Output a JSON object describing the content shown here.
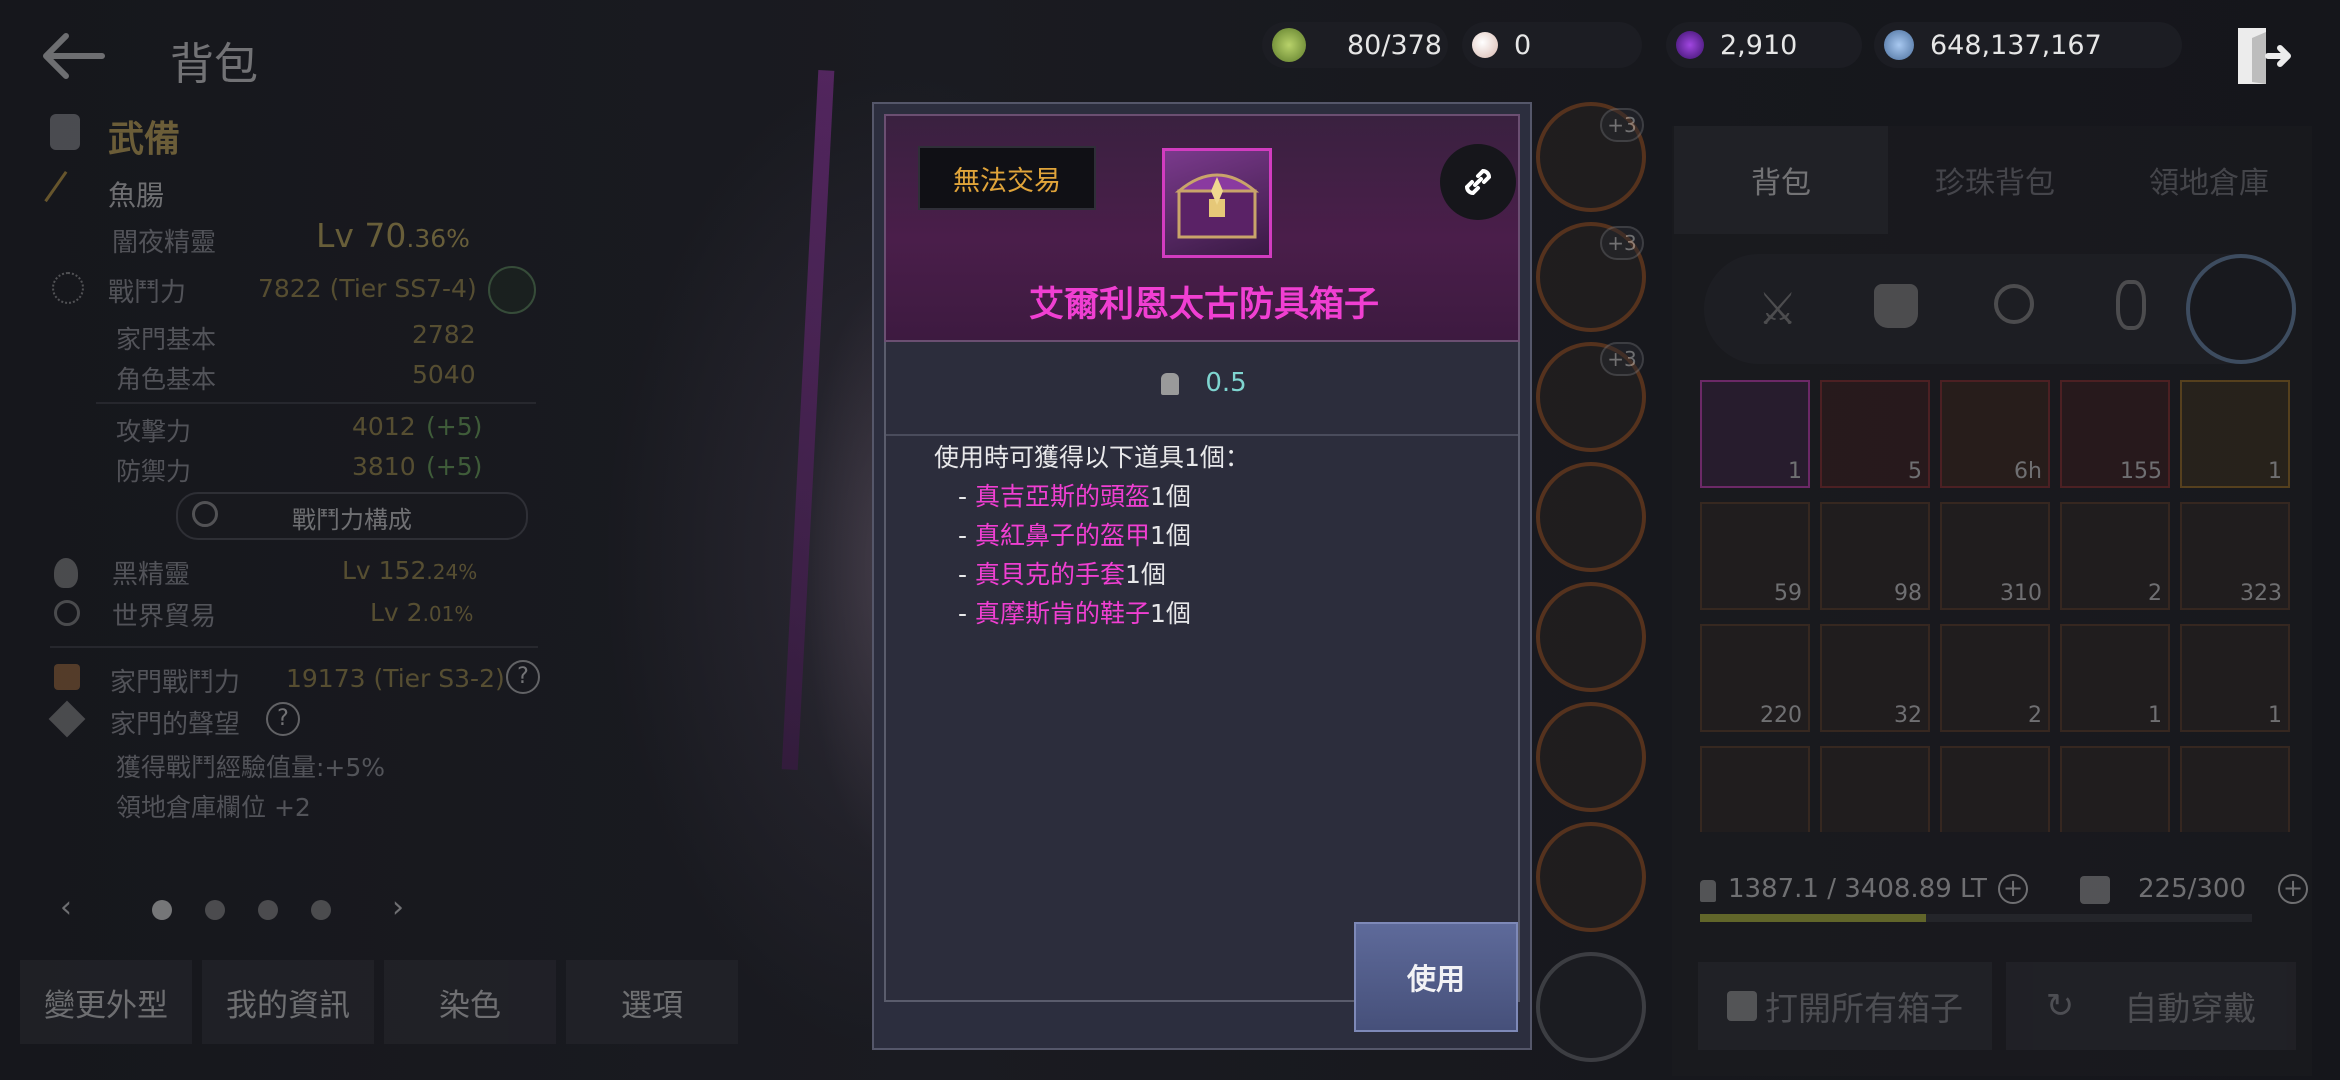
{
  "header": {
    "title": "背包"
  },
  "currencies": [
    {
      "icon": "energy-icon",
      "value": "80/378"
    },
    {
      "icon": "pearl-icon",
      "value": "0"
    },
    {
      "icon": "contribution-icon",
      "value": "2,910"
    },
    {
      "icon": "silver-icon",
      "value": "648,137,167"
    }
  ],
  "left": {
    "section_title": "武備",
    "character_name": "魚腸",
    "class_name": "闇夜精靈",
    "level": "Lv 70",
    "level_pct": ".36%",
    "power_label": "戰鬥力",
    "power_value": "7822 (Tier SS7-4)",
    "family_base_label": "家門基本",
    "family_base_value": "2782",
    "char_base_label": "角色基本",
    "char_base_value": "5040",
    "attack_label": "攻擊力",
    "attack_value": "4012",
    "attack_bonus": "(+5)",
    "defense_label": "防禦力",
    "defense_value": "3810",
    "defense_bonus": "(+5)",
    "power_breakdown_button": "戰鬥力構成",
    "black_spirit_label": "黑精靈",
    "black_spirit_level": "Lv 152",
    "black_spirit_pct": ".24%",
    "trade_label": "世界貿易",
    "trade_level": "Lv 2",
    "trade_pct": ".01%",
    "family_power_label": "家門戰鬥力",
    "family_power_value": "19173 (Tier S3-2)",
    "fame_label": "家門的聲望",
    "fame_bonus1": "獲得戰鬥經驗值量:+5%",
    "fame_bonus2": "領地倉庫欄位 +2",
    "bottom_buttons": [
      "變更外型",
      "我的資訊",
      "染色",
      "選項"
    ]
  },
  "equip_slots": [
    "+3",
    "+3",
    "+3"
  ],
  "inventory": {
    "tabs": [
      "背包",
      "珍珠背包",
      "領地倉庫"
    ],
    "items_row1": [
      "1",
      "5",
      "6h",
      "155",
      "1"
    ],
    "items_row2": [
      "59",
      "98",
      "310",
      "2",
      "323"
    ],
    "items_row3": [
      "220",
      "32",
      "2",
      "1",
      "1"
    ],
    "weight": "1387.1 / 3408.89 LT",
    "weight_fraction": 0.41,
    "slots": "225/300",
    "open_all_button": "打開所有箱子",
    "auto_equip_button": "自動穿戴"
  },
  "popup": {
    "trade_status": "無法交易",
    "item_name": "艾爾利恩太古防具箱子",
    "weight": "0.5",
    "description": "使用時可獲得以下道具1個：",
    "rewards": [
      {
        "name": "真吉亞斯的頭盔",
        "qty": "1個"
      },
      {
        "name": "真紅鼻子的盔甲",
        "qty": "1個"
      },
      {
        "name": "真貝克的手套",
        "qty": "1個"
      },
      {
        "name": "真摩斯肯的鞋子",
        "qty": "1個"
      }
    ],
    "use_button": "使用"
  },
  "colors": {
    "accent_pink": "#f03fd2",
    "gold": "#e0a43a",
    "teal": "#7fd5d0"
  }
}
